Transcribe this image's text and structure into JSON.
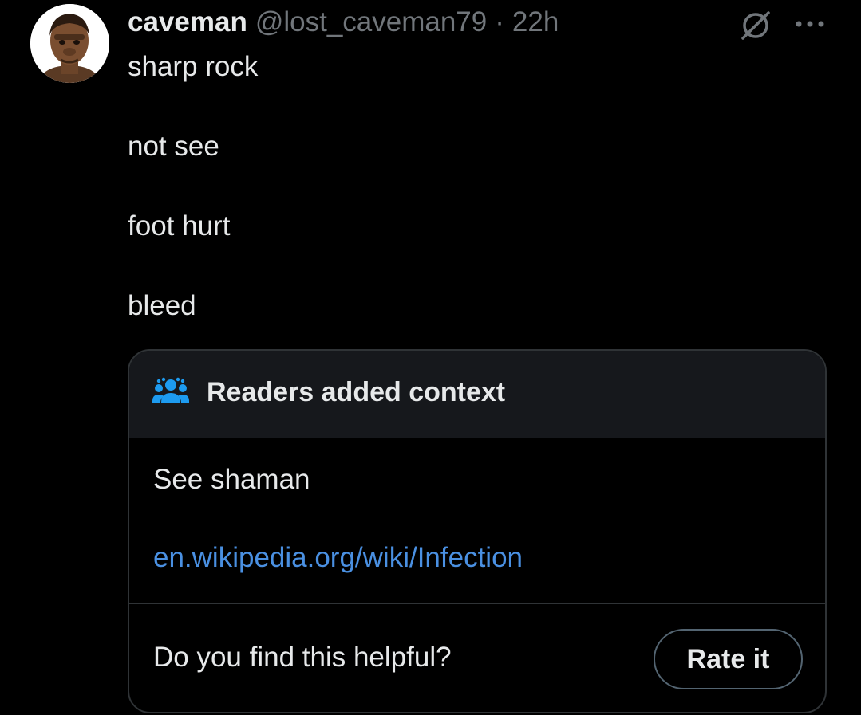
{
  "post": {
    "author": {
      "display_name": "caveman",
      "handle": "@lost_caveman79",
      "separator": "·",
      "time": "22h",
      "avatar_icon": "caveman-portrait"
    },
    "text_lines": [
      "sharp rock",
      "not see",
      "foot hurt",
      "bleed"
    ],
    "actions": {
      "grok_icon": "grok-icon",
      "more_icon": "more-horizontal-icon"
    }
  },
  "community_note": {
    "header_icon": "people-icon",
    "title": "Readers added context",
    "body": "See shaman",
    "link": "en.wikipedia.org/wiki/Infection",
    "helpful_prompt": "Do you find this helpful?",
    "rate_button_label": "Rate it"
  },
  "colors": {
    "background": "#000000",
    "primary_text": "#e7e9ea",
    "secondary_text": "#71767b",
    "link": "#4a90e2",
    "note_header_bg": "#16181c",
    "border": "#2f3336",
    "people_icon": "#1d9bf0"
  }
}
